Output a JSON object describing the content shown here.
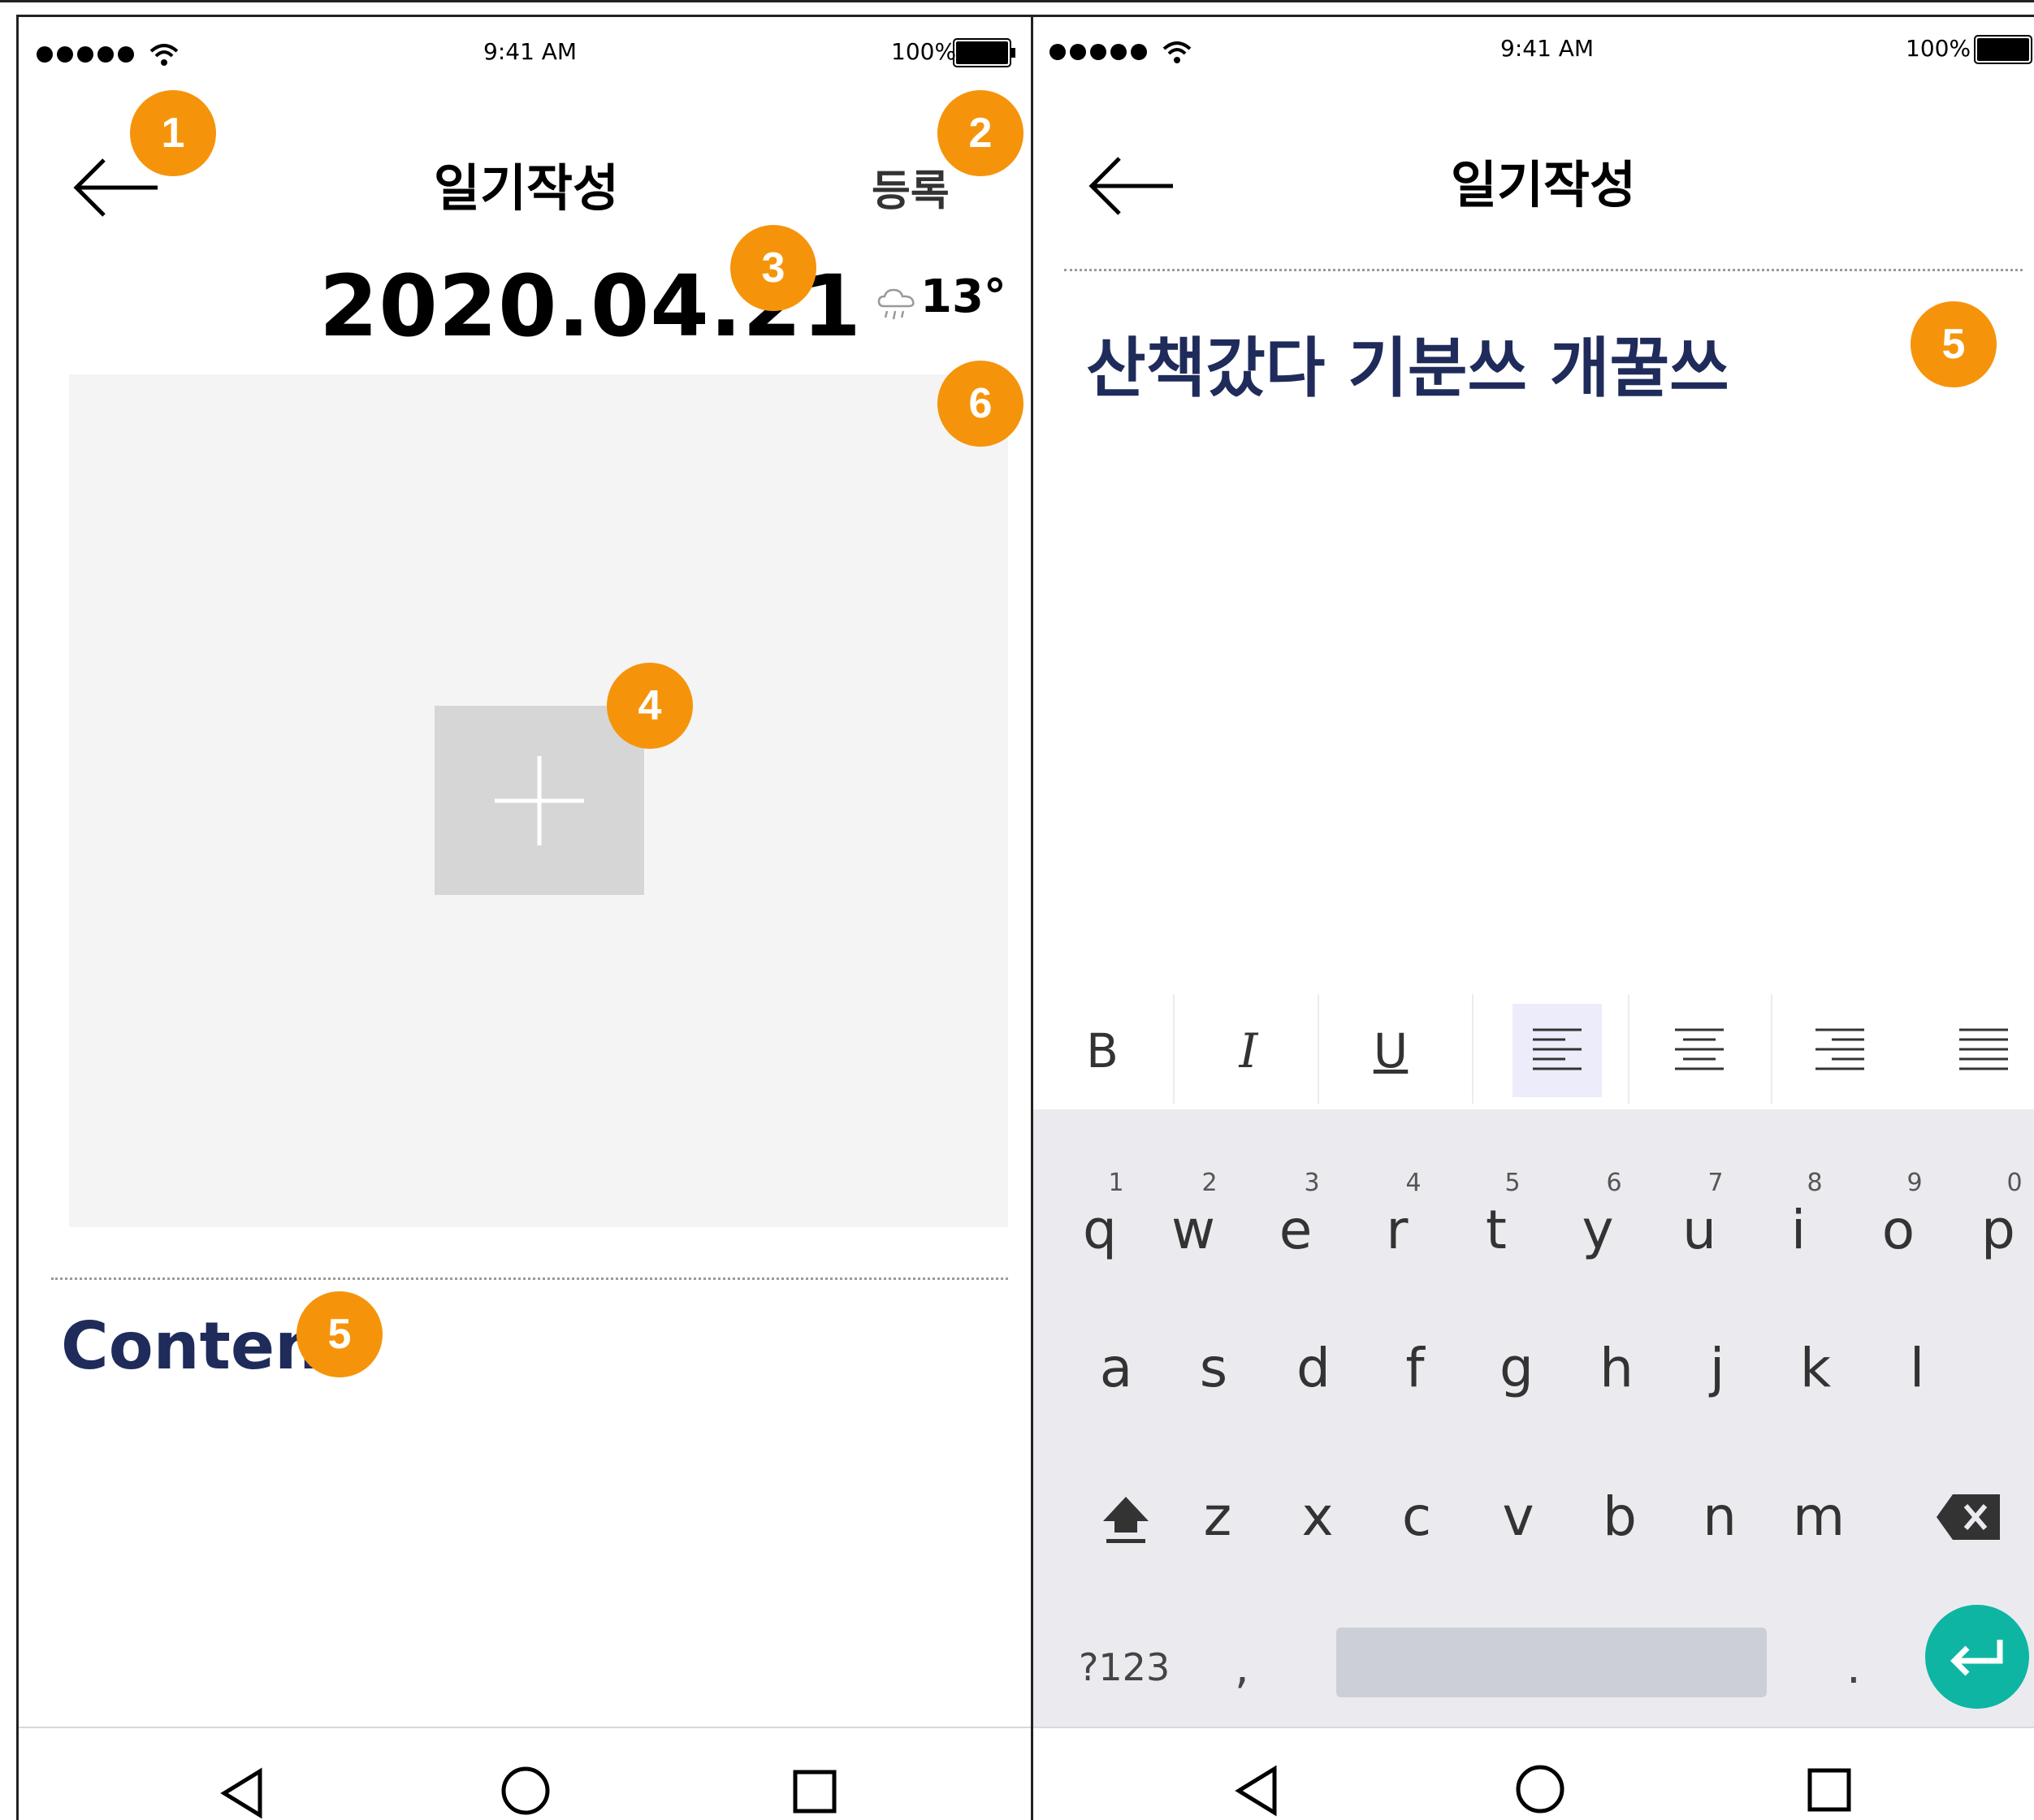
{
  "status_bar": {
    "time": "9:41 AM",
    "battery": "100%"
  },
  "header": {
    "title": "일기작성",
    "register_label": "등록"
  },
  "entry": {
    "date": "2020.04.21",
    "temperature": "13°",
    "content_placeholder": "Content",
    "typed_text": "산책갔다 기분쓰 개꿀쓰"
  },
  "badges": [
    "1",
    "2",
    "3",
    "4",
    "5",
    "6",
    "5"
  ],
  "format_toolbar": {
    "bold": "B",
    "italic": "I",
    "underline": "U"
  },
  "keyboard": {
    "row1": [
      "q",
      "w",
      "e",
      "r",
      "t",
      "y",
      "u",
      "i",
      "o",
      "p"
    ],
    "row1_hints": [
      "1",
      "2",
      "3",
      "4",
      "5",
      "6",
      "7",
      "8",
      "9",
      "0"
    ],
    "row2": [
      "a",
      "s",
      "d",
      "f",
      "g",
      "h",
      "j",
      "k",
      "l"
    ],
    "row3": [
      "z",
      "x",
      "c",
      "v",
      "b",
      "n",
      "m"
    ],
    "symbols_label": "?123",
    "comma": ",",
    "period": "."
  },
  "icons": {
    "back": "arrow-left-icon",
    "weather": "cloud-rain-icon",
    "add_photo": "plus-icon",
    "nav_back": "triangle-back-icon",
    "nav_home": "circle-home-icon",
    "nav_recent": "square-recent-icon",
    "shift": "shift-icon",
    "backspace": "backspace-icon",
    "enter": "enter-icon"
  },
  "colors": {
    "badge": "#f5940b",
    "content_text": "#1f2b5a",
    "enter_key": "#0fb5a3",
    "active_format": "#ececfb"
  }
}
